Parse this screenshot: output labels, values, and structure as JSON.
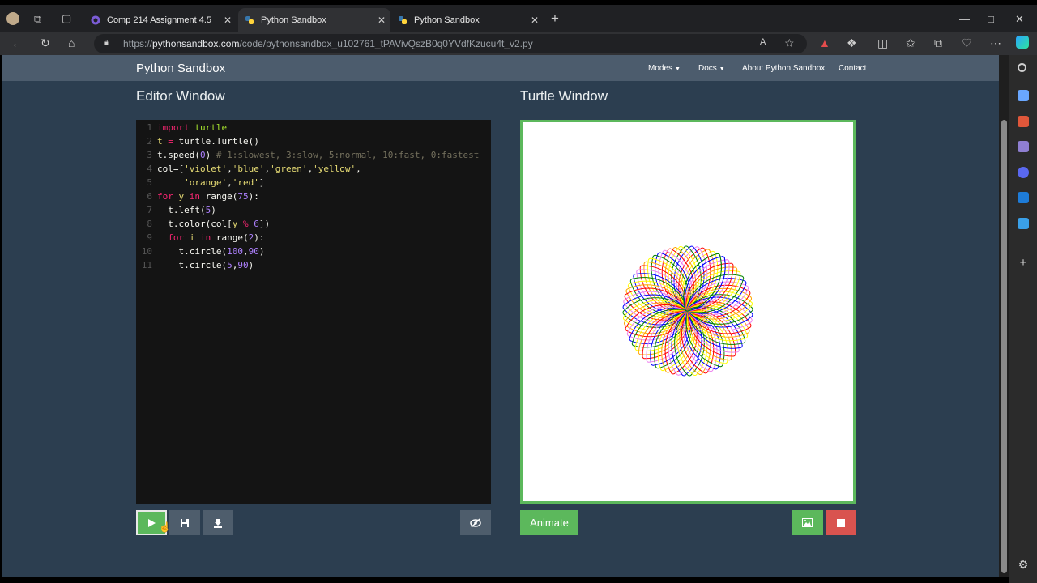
{
  "browser": {
    "tabs": [
      {
        "label": "Comp 214 Assignment 4.5",
        "active": false
      },
      {
        "label": "Python Sandbox",
        "active": true
      },
      {
        "label": "Python Sandbox",
        "active": false
      }
    ],
    "new_tab_label": "+",
    "url_prefix": "https://",
    "url_host": "pythonsandbox.com",
    "url_path": "/code/pythonsandbox_u102761_tPAVivQszB0q0YVdfKzucu4t_v2.py"
  },
  "navbar": {
    "brand": "Python Sandbox",
    "links": [
      "Modes",
      "Docs",
      "About Python Sandbox",
      "Contact"
    ]
  },
  "editor": {
    "title": "Editor Window",
    "lines": [
      {
        "n": "1",
        "code": "import turtle"
      },
      {
        "n": "2",
        "code": "t = turtle.Turtle()"
      },
      {
        "n": "3",
        "code": "t.speed(0) # 1:slowest, 3:slow, 5:normal, 10:fast, 0:fastest"
      },
      {
        "n": "4",
        "code": "col=['violet','blue','green','yellow',"
      },
      {
        "n": "5",
        "code": "     'orange','red']"
      },
      {
        "n": "6",
        "code": "for y in range(75):"
      },
      {
        "n": "7",
        "code": "  t.left(5)"
      },
      {
        "n": "8",
        "code": "  t.color(col[y % 6])"
      },
      {
        "n": "9",
        "code": "  for i in range(2):"
      },
      {
        "n": "10",
        "code": "    t.circle(100,90)"
      },
      {
        "n": "11",
        "code": "    t.circle(5,90)"
      }
    ]
  },
  "turtle": {
    "title": "Turtle Window",
    "animate_label": "Animate",
    "colors": [
      "#ee82ee",
      "#0000ff",
      "#008000",
      "#ffff00",
      "#ffa500",
      "#ff0000"
    ]
  },
  "icons": {
    "run": "play-icon",
    "save": "floppy-icon",
    "download": "download-icon",
    "hide": "eye-slash-icon",
    "image": "image-icon",
    "stop": "stop-icon"
  }
}
